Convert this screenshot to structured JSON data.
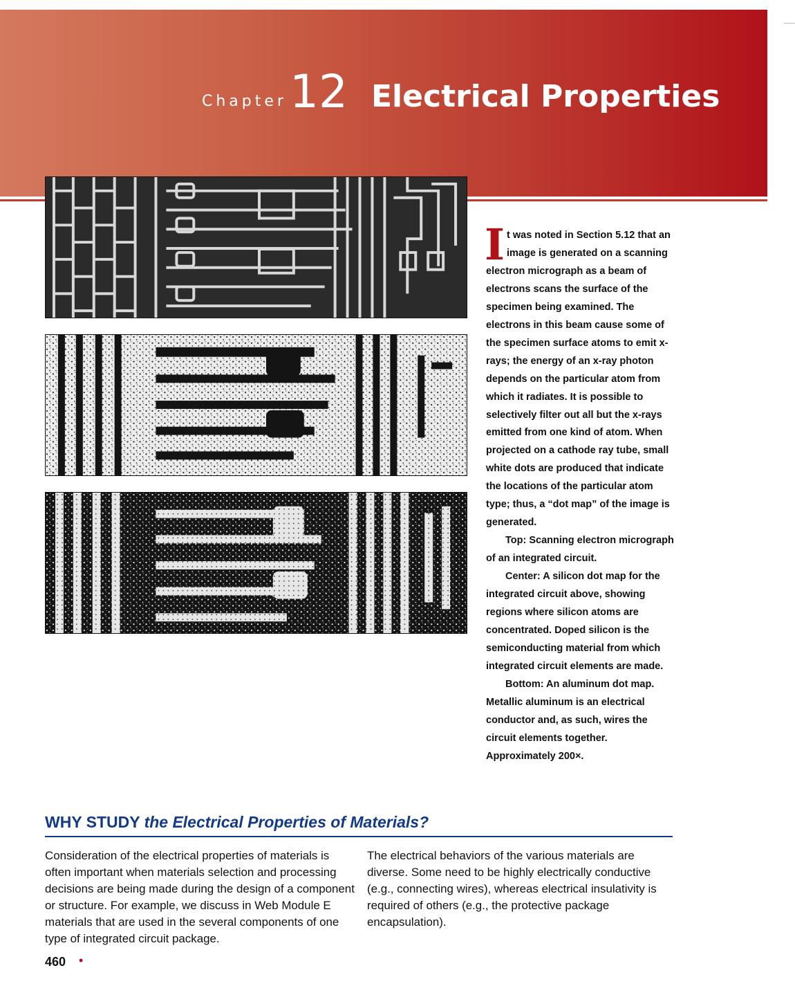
{
  "chapter": {
    "label": "Chapter",
    "number": "12",
    "title": "Electrical Properties"
  },
  "micrographs": [
    {
      "kind": "sem",
      "caption_ref": "Top"
    },
    {
      "kind": "silicon-dot-map",
      "caption_ref": "Center"
    },
    {
      "kind": "aluminum-dot-map",
      "caption_ref": "Bottom"
    }
  ],
  "intro": {
    "dropcap": "I",
    "para1": "t was noted in Section 5.12 that an image is generated on a scanning electron micrograph as a beam of electrons scans the surface of the specimen being examined. The electrons in this beam cause some of the specimen surface atoms to emit x-rays; the energy of an x-ray photon depends on the particular atom from which it radiates. It is possible to selectively filter out all but the x-rays emitted from one kind of atom. When projected on a cathode ray tube, small white dots are produced that indicate the locations of the particular atom type; thus, a “dot map” of the image is generated.",
    "para2": "Top: Scanning electron micrograph of an integrated circuit.",
    "para3": "Center: A silicon dot map for the integrated circuit above, showing regions where silicon atoms are concentrated. Doped silicon is the semiconducting material from which integrated circuit elements are made.",
    "para4": "Bottom: An aluminum dot map. Metallic aluminum is an electrical conductor and, as such, wires the circuit elements together. Approximately 200×."
  },
  "why": {
    "lead": "WHY STUDY",
    "emph": "the Electrical Properties of Materials?",
    "col1": "Consideration of the electrical properties of materials is often important when materials selection and processing decisions are being made during the design of a component or structure. For example, we discuss in Web Module E materials that are used in the several components of one type of integrated circuit package.",
    "col2": "The electrical behaviors of the various materials are diverse. Some need to be highly electrically conductive (e.g., connecting wires), whereas electrical insulativity is required of others (e.g., the protective package encapsulation)."
  },
  "page_number": "460",
  "colors": {
    "banner_start": "#d4795e",
    "banner_end": "#b0121a",
    "heading_blue": "#123a87",
    "accent_red": "#b0121a"
  }
}
